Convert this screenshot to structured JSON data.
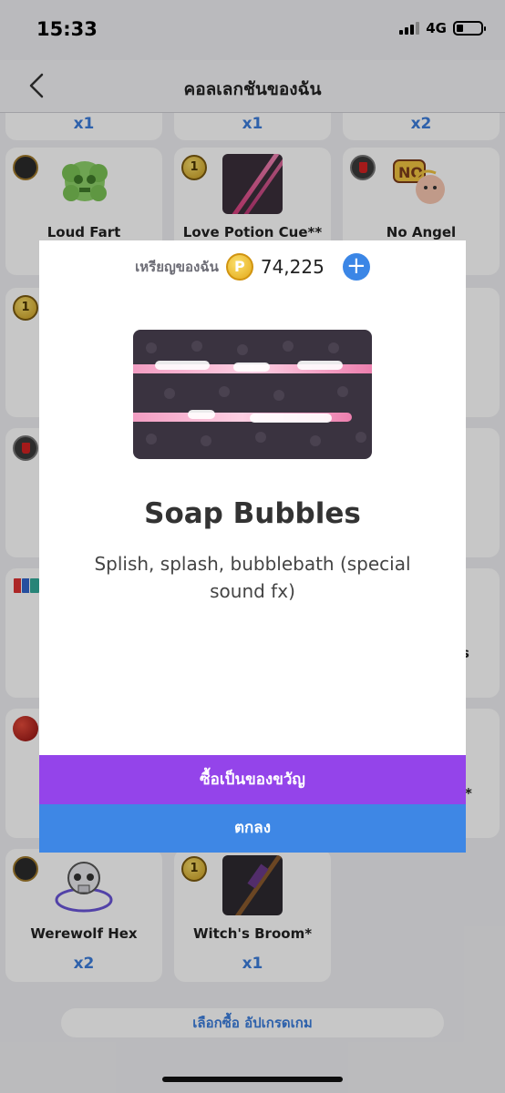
{
  "status": {
    "time": "15:33",
    "network": "4G"
  },
  "nav": {
    "title": "คอลเลกชันของฉัน"
  },
  "top_quantities": [
    "x1",
    "x1",
    "x2"
  ],
  "row1": [
    {
      "name": "Loud Fart"
    },
    {
      "name": "Love Potion Cue**"
    },
    {
      "name": "No Angel"
    }
  ],
  "right_edge_fragments": [
    "s",
    "*"
  ],
  "row_last": [
    {
      "name": "Werewolf Hex",
      "qty": "x2"
    },
    {
      "name": "Witch's Broom*",
      "qty": "x1"
    }
  ],
  "bottom_button": "เลือกซื้อ อัปเกรดเกม",
  "modal": {
    "coins_label": "เหรียญของฉัน",
    "coin_symbol": "P",
    "coins_value": "74,225",
    "add_symbol": "+",
    "item_title": "Soap Bubbles",
    "item_description": "Splish, splash, bubblebath (special sound fx)",
    "gift_button": "ซื้อเป็นของขวัญ",
    "ok_button": "ตกลง"
  },
  "colors": {
    "accent_blue": "#3e87e5",
    "gift_purple": "#9444ea",
    "coin_gold": "#e3a818"
  }
}
